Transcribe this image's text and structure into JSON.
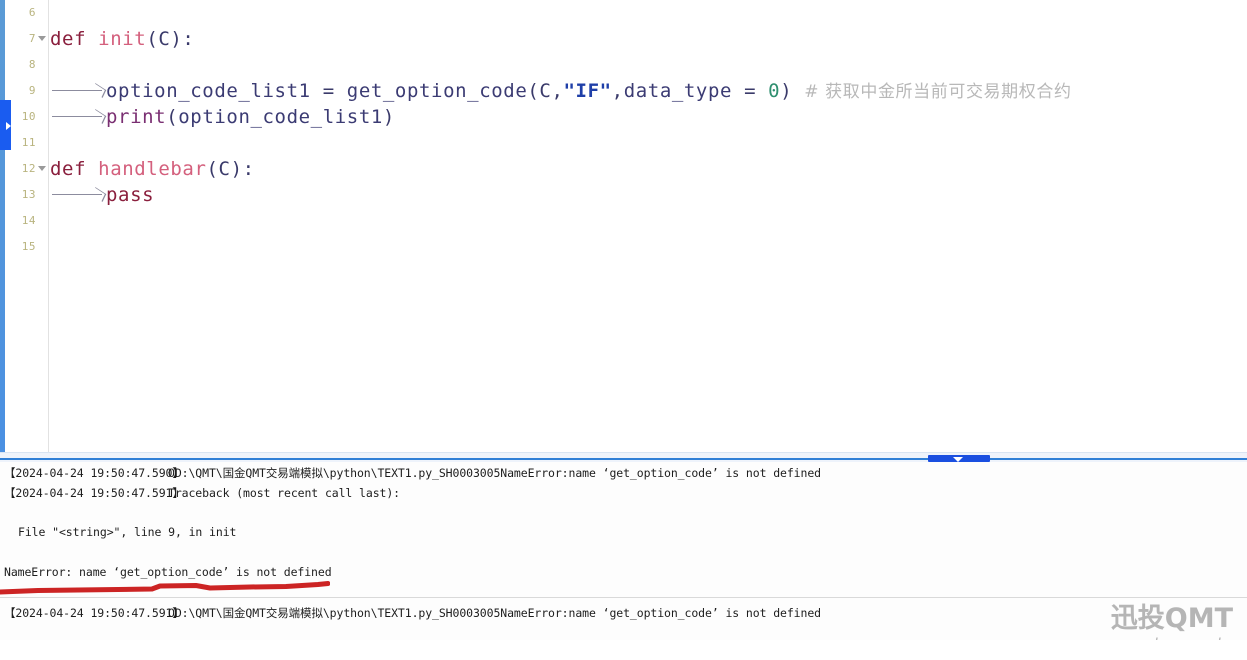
{
  "editor": {
    "lines": [
      {
        "number": "6",
        "fold": false,
        "indent": 0,
        "tokens": []
      },
      {
        "number": "7",
        "fold": true,
        "indent": 0,
        "tokens": [
          {
            "cls": "tok-kw",
            "text": "def "
          },
          {
            "cls": "tok-fname",
            "text": "init"
          },
          {
            "cls": "tok-punct",
            "text": "(C):"
          }
        ]
      },
      {
        "number": "8",
        "fold": false,
        "indent": 0,
        "tokens": []
      },
      {
        "number": "9",
        "fold": false,
        "indent": 1,
        "tokens": [
          {
            "cls": "tok-ident",
            "text": "option_code_list1 "
          },
          {
            "cls": "tok-op",
            "text": "= "
          },
          {
            "cls": "tok-ident",
            "text": "get_option_code"
          },
          {
            "cls": "tok-punct",
            "text": "(C,"
          },
          {
            "cls": "tok-str",
            "text": "\"IF\""
          },
          {
            "cls": "tok-punct",
            "text": ","
          },
          {
            "cls": "tok-ident",
            "text": "data_type "
          },
          {
            "cls": "tok-op",
            "text": "= "
          },
          {
            "cls": "tok-num",
            "text": "0"
          },
          {
            "cls": "tok-punct",
            "text": ") "
          },
          {
            "cls": "tok-comment",
            "text": "# 获取中金所当前可交易期权合约"
          }
        ]
      },
      {
        "number": "10",
        "fold": false,
        "indent": 1,
        "tokens": [
          {
            "cls": "tok-builtin",
            "text": "print"
          },
          {
            "cls": "tok-punct",
            "text": "("
          },
          {
            "cls": "tok-ident",
            "text": "option_code_list1"
          },
          {
            "cls": "tok-punct",
            "text": ")"
          }
        ]
      },
      {
        "number": "11",
        "fold": false,
        "indent": 0,
        "tokens": []
      },
      {
        "number": "12",
        "fold": true,
        "indent": 0,
        "tokens": [
          {
            "cls": "tok-kw",
            "text": "def "
          },
          {
            "cls": "tok-fname",
            "text": "handlebar"
          },
          {
            "cls": "tok-punct",
            "text": "(C):"
          }
        ]
      },
      {
        "number": "13",
        "fold": false,
        "indent": 1,
        "tokens": [
          {
            "cls": "tok-kw",
            "text": "pass"
          }
        ]
      },
      {
        "number": "14",
        "fold": false,
        "indent": 0,
        "tokens": []
      },
      {
        "number": "15",
        "fold": false,
        "indent": 0,
        "tokens": []
      }
    ]
  },
  "console": {
    "entries": [
      {
        "id": "con-line1",
        "kind": "timestamped",
        "timestamp": "【2024-04-24 19:50:47.590】",
        "message": "OD:\\QMT\\国金QMT交易端模拟\\python\\TEXT1.py_SH0003005NameError:name ‘get_option_code’ is not defined"
      },
      {
        "id": "con-line2",
        "kind": "timestamped",
        "timestamp": "【2024-04-24 19:50:47.591】",
        "message": "Traceback (most recent call last):"
      },
      {
        "id": "con-line3",
        "kind": "plain",
        "text": "File \"<string>\", line 9, in init"
      },
      {
        "id": "con-line4",
        "kind": "plain",
        "text": "NameError: name ‘get_option_code’ is not defined"
      },
      {
        "id": "con-line5",
        "kind": "timestamped",
        "timestamp": "【2024-04-24 19:50:47.591】",
        "message": "OD:\\QMT\\国金QMT交易端模拟\\python\\TEXT1.py_SH0003005NameError:name ‘get_option_code’ is not defined"
      }
    ]
  },
  "annotations": {
    "underline_color": "#cc2424"
  },
  "watermark": {
    "main": "迅投QMT",
    "sub": "xuntou.net",
    "color": "#b5b5b5"
  },
  "colors": {
    "splitter_blue": "#2f7fd6",
    "handle_blue": "#1a4fe0",
    "marker_blue": "#1a5cf0",
    "edge_strip": "#4a90e2"
  }
}
